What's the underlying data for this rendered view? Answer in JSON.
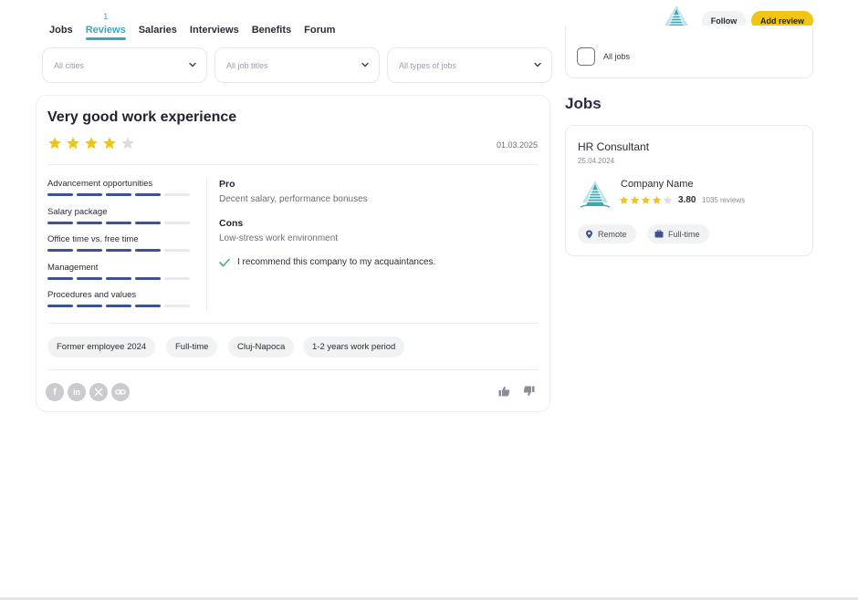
{
  "nav": {
    "items": [
      {
        "label": "Jobs",
        "active": false
      },
      {
        "label": "Reviews",
        "active": true,
        "count": "1"
      },
      {
        "label": "Salaries",
        "active": false
      },
      {
        "label": "Interviews",
        "active": false
      },
      {
        "label": "Benefits",
        "active": false
      },
      {
        "label": "Forum",
        "active": false
      }
    ]
  },
  "header": {
    "follow_label": "Follow",
    "add_review_label": "Add review"
  },
  "filters": {
    "cities": "All cities",
    "job_titles": "All job titles",
    "job_types": "All types of jobs"
  },
  "side_filter": {
    "all_jobs_label": "All jobs"
  },
  "review": {
    "title": "Very good work experience",
    "rating": 4,
    "max_rating": 5,
    "date": "01.03.2025",
    "ratings": [
      {
        "label": "Advancement opportunities",
        "value": 4,
        "max": 5
      },
      {
        "label": "Salary package",
        "value": 4,
        "max": 5
      },
      {
        "label": "Office time vs. free time",
        "value": 4,
        "max": 5
      },
      {
        "label": "Management",
        "value": 4,
        "max": 5
      },
      {
        "label": "Procedures and values",
        "value": 4,
        "max": 5
      }
    ],
    "pro_label": "Pro",
    "pro_text": "Decent salary, performance bonuses",
    "cons_label": "Cons",
    "cons_text": "Low-stress work environment",
    "recommend_text": "I recommend this company to my acquaintances.",
    "tags": [
      "Former employee 2024",
      "Full-time",
      "Cluj-Napoca",
      "1-2 years work period"
    ]
  },
  "jobs": {
    "heading": "Jobs",
    "card": {
      "title": "HR Consultant",
      "date": "25.04.2024",
      "company_name": "Company Name",
      "company_rating": "3.80",
      "company_stars": 4,
      "company_reviews": "1035 reviews",
      "chips": [
        {
          "label": "Remote",
          "icon": "location-pin-icon"
        },
        {
          "label": "Full-time",
          "icon": "briefcase-icon"
        }
      ]
    }
  },
  "colors": {
    "accent": "#3aa7b3",
    "star": "#f2c514",
    "bar": "#3d5290",
    "add_review": "#f2c514"
  }
}
